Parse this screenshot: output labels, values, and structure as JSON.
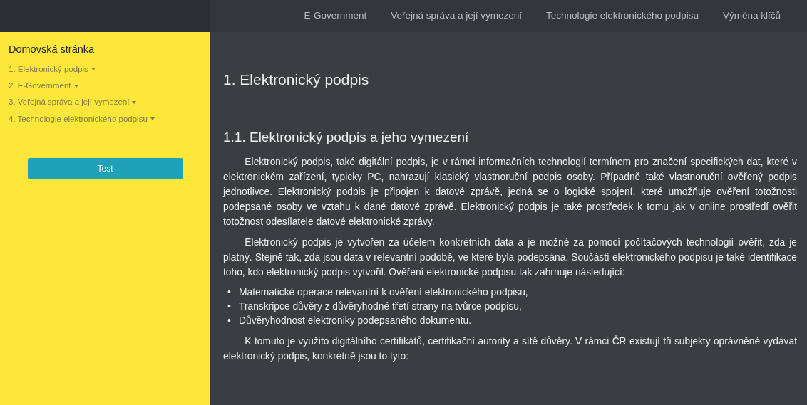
{
  "navbar": {
    "links": [
      "E-Government",
      "Veřejná správa a její vymezení",
      "Technologie elektronického podpisu",
      "Výměna klíčů"
    ]
  },
  "sidebar": {
    "title": "Domovská stránka",
    "items": [
      {
        "label": "1. Elektronický podpis"
      },
      {
        "label": "2. E-Government"
      },
      {
        "label": "3. Veřejná správa a její vymezení"
      },
      {
        "label": "4. Technologie elektronického podpisu"
      }
    ],
    "button": "Test"
  },
  "content": {
    "heading": "1. Elektronický podpis",
    "subheading": "1.1. Elektronický podpis a jeho vymezení",
    "blocks": [
      {
        "kind": "paragraph",
        "text": "Elektronický podpis, také digitální podpis, je v rámci informačních technologií termínem pro značení specifických dat, které v elektronickém zařízení, typicky PC, nahrazují klasický vlastnoruční podpis osoby. Případně také vlastnoruční ověřený podpis jednotlivce. Elektronický podpis je připojen k datové zprávě, jedná se o logické spojení, které umožňuje ověření totožnosti podepsané osoby ve vztahu k dané datové zprávě. Elektronický podpis je také prostředek k tomu jak v online prostředí ověřit totožnost odesílatele datové elektronické zprávy."
      },
      {
        "kind": "paragraph",
        "text": "Elektronický podpis je vytvořen za účelem konkrétních data a je možné za pomocí počítačových technologií ověřit, zda je platný. Stejně tak, zda jsou data v relevantní podobě, ve které byla podepsána. Součástí elektronického podpisu je také identifikace toho, kdo elektronický podpis vytvořil. Ověření elektronické podpisu tak zahrnuje následující:"
      },
      {
        "kind": "list",
        "items": [
          {
            "bullet": "•",
            "text": "Matematické operace relevantní k ověření elektronického podpisu,"
          },
          {
            "bullet": "•",
            "text": "Transkripce důvěry z důvěryhodné třetí strany na tvůrce podpisu,"
          },
          {
            "bullet": "•",
            "text": "Důvěryhodnost elektroniky podepsaného dokumentu."
          }
        ]
      },
      {
        "kind": "paragraph",
        "text": "K tomuto je využito digitálního certifikátů, certifikační autority a sítě důvěry. V rámci ČR existují tři subjekty oprávněné vydávat elektronický podpis, konkrétně jsou to tyto:"
      }
    ]
  }
}
